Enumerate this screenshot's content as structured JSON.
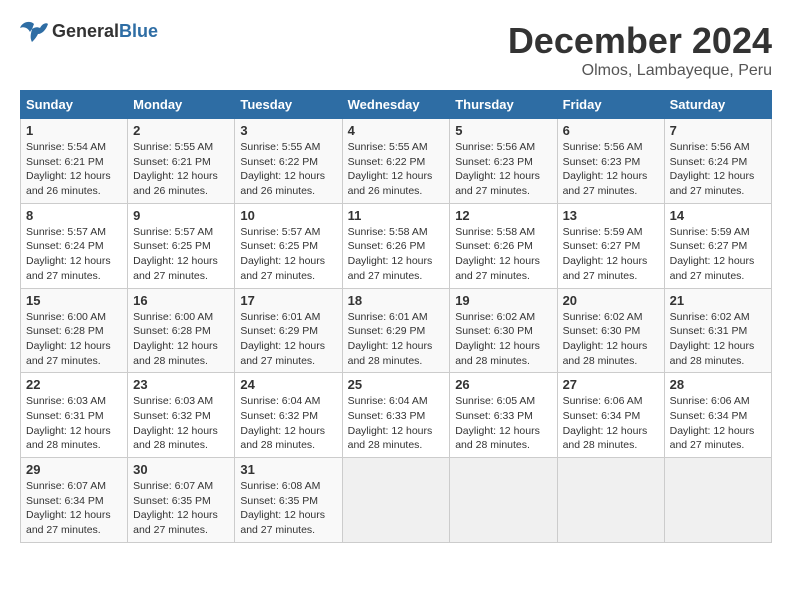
{
  "logo": {
    "general": "General",
    "blue": "Blue"
  },
  "title": "December 2024",
  "subtitle": "Olmos, Lambayeque, Peru",
  "weekdays": [
    "Sunday",
    "Monday",
    "Tuesday",
    "Wednesday",
    "Thursday",
    "Friday",
    "Saturday"
  ],
  "weeks": [
    [
      {
        "day": 1,
        "sunrise": "5:54 AM",
        "sunset": "6:21 PM",
        "daylight": "12 hours and 26 minutes."
      },
      {
        "day": 2,
        "sunrise": "5:55 AM",
        "sunset": "6:21 PM",
        "daylight": "12 hours and 26 minutes."
      },
      {
        "day": 3,
        "sunrise": "5:55 AM",
        "sunset": "6:22 PM",
        "daylight": "12 hours and 26 minutes."
      },
      {
        "day": 4,
        "sunrise": "5:55 AM",
        "sunset": "6:22 PM",
        "daylight": "12 hours and 26 minutes."
      },
      {
        "day": 5,
        "sunrise": "5:56 AM",
        "sunset": "6:23 PM",
        "daylight": "12 hours and 27 minutes."
      },
      {
        "day": 6,
        "sunrise": "5:56 AM",
        "sunset": "6:23 PM",
        "daylight": "12 hours and 27 minutes."
      },
      {
        "day": 7,
        "sunrise": "5:56 AM",
        "sunset": "6:24 PM",
        "daylight": "12 hours and 27 minutes."
      }
    ],
    [
      {
        "day": 8,
        "sunrise": "5:57 AM",
        "sunset": "6:24 PM",
        "daylight": "12 hours and 27 minutes."
      },
      {
        "day": 9,
        "sunrise": "5:57 AM",
        "sunset": "6:25 PM",
        "daylight": "12 hours and 27 minutes."
      },
      {
        "day": 10,
        "sunrise": "5:57 AM",
        "sunset": "6:25 PM",
        "daylight": "12 hours and 27 minutes."
      },
      {
        "day": 11,
        "sunrise": "5:58 AM",
        "sunset": "6:26 PM",
        "daylight": "12 hours and 27 minutes."
      },
      {
        "day": 12,
        "sunrise": "5:58 AM",
        "sunset": "6:26 PM",
        "daylight": "12 hours and 27 minutes."
      },
      {
        "day": 13,
        "sunrise": "5:59 AM",
        "sunset": "6:27 PM",
        "daylight": "12 hours and 27 minutes."
      },
      {
        "day": 14,
        "sunrise": "5:59 AM",
        "sunset": "6:27 PM",
        "daylight": "12 hours and 27 minutes."
      }
    ],
    [
      {
        "day": 15,
        "sunrise": "6:00 AM",
        "sunset": "6:28 PM",
        "daylight": "12 hours and 27 minutes."
      },
      {
        "day": 16,
        "sunrise": "6:00 AM",
        "sunset": "6:28 PM",
        "daylight": "12 hours and 28 minutes."
      },
      {
        "day": 17,
        "sunrise": "6:01 AM",
        "sunset": "6:29 PM",
        "daylight": "12 hours and 27 minutes."
      },
      {
        "day": 18,
        "sunrise": "6:01 AM",
        "sunset": "6:29 PM",
        "daylight": "12 hours and 28 minutes."
      },
      {
        "day": 19,
        "sunrise": "6:02 AM",
        "sunset": "6:30 PM",
        "daylight": "12 hours and 28 minutes."
      },
      {
        "day": 20,
        "sunrise": "6:02 AM",
        "sunset": "6:30 PM",
        "daylight": "12 hours and 28 minutes."
      },
      {
        "day": 21,
        "sunrise": "6:02 AM",
        "sunset": "6:31 PM",
        "daylight": "12 hours and 28 minutes."
      }
    ],
    [
      {
        "day": 22,
        "sunrise": "6:03 AM",
        "sunset": "6:31 PM",
        "daylight": "12 hours and 28 minutes."
      },
      {
        "day": 23,
        "sunrise": "6:03 AM",
        "sunset": "6:32 PM",
        "daylight": "12 hours and 28 minutes."
      },
      {
        "day": 24,
        "sunrise": "6:04 AM",
        "sunset": "6:32 PM",
        "daylight": "12 hours and 28 minutes."
      },
      {
        "day": 25,
        "sunrise": "6:04 AM",
        "sunset": "6:33 PM",
        "daylight": "12 hours and 28 minutes."
      },
      {
        "day": 26,
        "sunrise": "6:05 AM",
        "sunset": "6:33 PM",
        "daylight": "12 hours and 28 minutes."
      },
      {
        "day": 27,
        "sunrise": "6:06 AM",
        "sunset": "6:34 PM",
        "daylight": "12 hours and 28 minutes."
      },
      {
        "day": 28,
        "sunrise": "6:06 AM",
        "sunset": "6:34 PM",
        "daylight": "12 hours and 27 minutes."
      }
    ],
    [
      {
        "day": 29,
        "sunrise": "6:07 AM",
        "sunset": "6:34 PM",
        "daylight": "12 hours and 27 minutes."
      },
      {
        "day": 30,
        "sunrise": "6:07 AM",
        "sunset": "6:35 PM",
        "daylight": "12 hours and 27 minutes."
      },
      {
        "day": 31,
        "sunrise": "6:08 AM",
        "sunset": "6:35 PM",
        "daylight": "12 hours and 27 minutes."
      },
      null,
      null,
      null,
      null
    ]
  ]
}
